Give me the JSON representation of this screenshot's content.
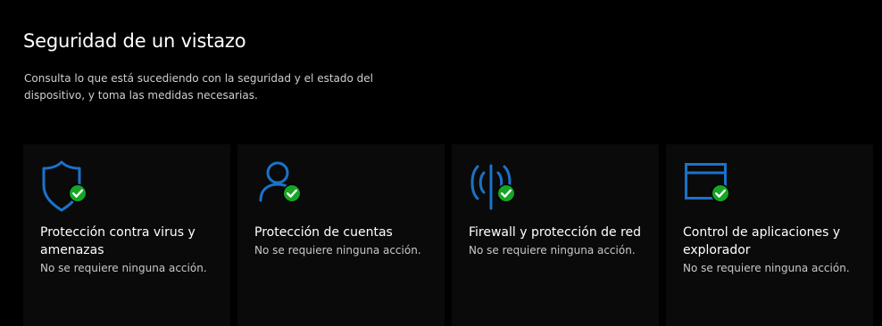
{
  "page": {
    "title": "Seguridad de un vistazo",
    "description": "Consulta lo que está sucediendo con la seguridad y el estado del dispositivo, y toma las medidas necesarias."
  },
  "colors": {
    "icon_blue": "#1a73c9",
    "check_green": "#16a524",
    "background": "#000000",
    "tile_background": "#0a0a0a"
  },
  "tiles": [
    {
      "title": "Protección contra virus y amenazas",
      "status": "No se requiere ninguna acción.",
      "icon": "shield-icon"
    },
    {
      "title": "Protección de cuentas",
      "status": "No se requiere ninguna acción.",
      "icon": "account-person-icon"
    },
    {
      "title": "Firewall y protección de red",
      "status": "No se requiere ninguna acción.",
      "icon": "wireless-antenna-icon"
    },
    {
      "title": "Control de aplicaciones y explorador",
      "status": "No se requiere ninguna acción.",
      "icon": "browser-window-icon"
    }
  ]
}
